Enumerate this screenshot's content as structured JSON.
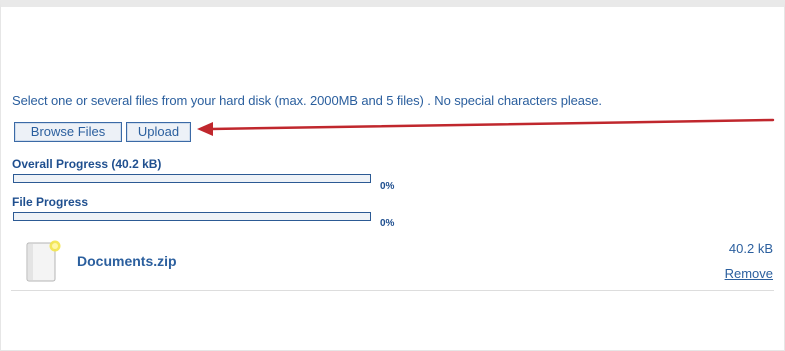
{
  "upload": {
    "instructions": "Select one or several files from your hard disk (max. 2000MB and 5 files) . No special characters please.",
    "browse_button_label": "Browse Files",
    "upload_button_label": "Upload",
    "overall_progress_label": "Overall Progress (40.2 kB)",
    "overall_progress_percent_text": "0%",
    "overall_progress_value": 0,
    "file_progress_label": "File Progress",
    "file_progress_percent_text": "0%",
    "file_progress_value": 0,
    "files": [
      {
        "name": "Documents.zip",
        "size": "40.2 kB",
        "remove_label": "Remove",
        "icon": "document-file-icon"
      }
    ]
  },
  "annotation": {
    "arrow_color": "#c0272d",
    "icon": "red-arrow-pointing-left"
  },
  "colors": {
    "text_blue": "#2b5f9e",
    "bar_border": "#2c5a94"
  }
}
